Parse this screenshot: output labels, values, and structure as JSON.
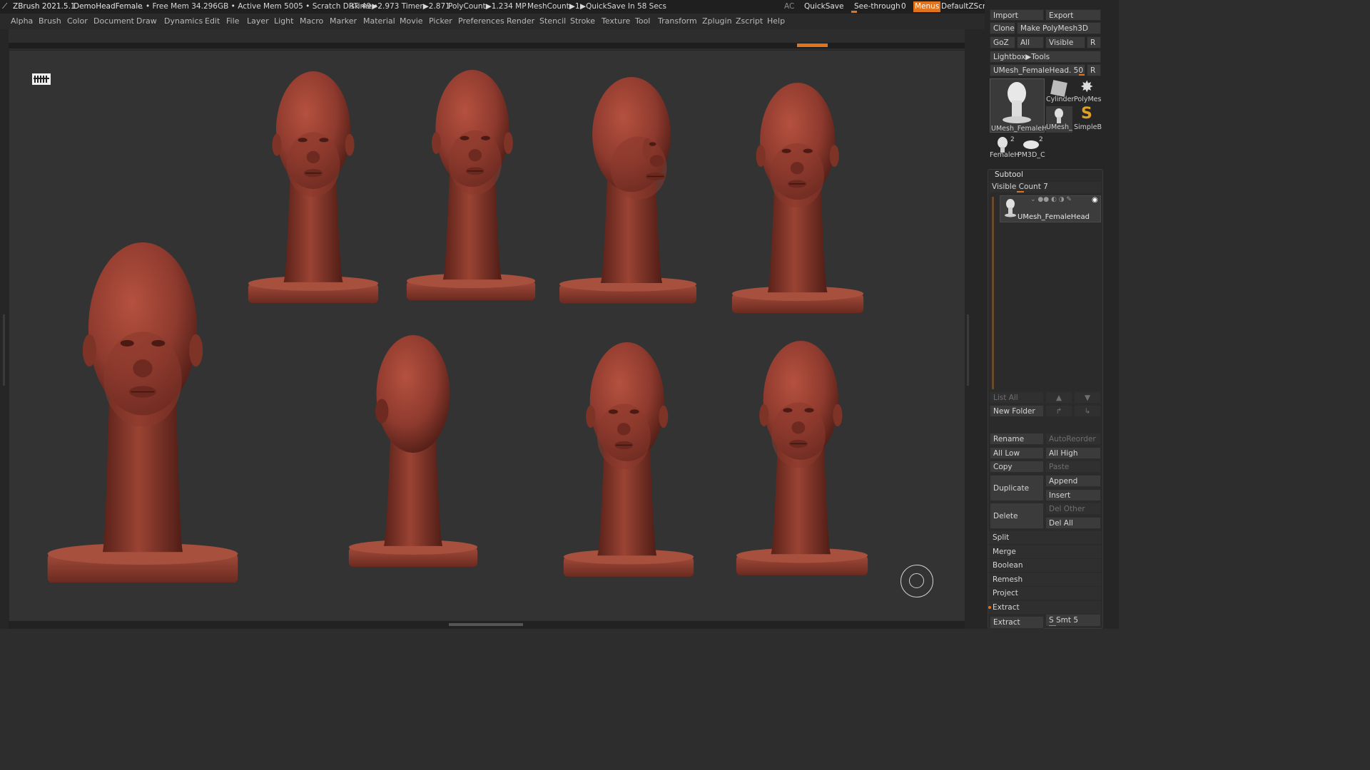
{
  "titlebar": {
    "app": "ZBrush 2021.5.1",
    "document": "DemoHeadFemale",
    "stats": ".. • Free Mem 34.296GB • Active Mem 5005 • Scratch Disk 49 •",
    "rtime": "RTime▶2.973 Timer▶2.871",
    "polycount": "PolyCount▶1.234 MP",
    "meshcount": "MeshCount▶1",
    "quicksave_status": "▶QuickSave In 58 Secs",
    "ac": "AC",
    "quicksave": "QuickSave",
    "seethrough_label": "See-through",
    "seethrough_value": "0",
    "menus": "Menus",
    "script": "DefaultZScript",
    "accent": "#e0731d"
  },
  "menubar": [
    "Alpha",
    "Brush",
    "Color",
    "Document",
    "Draw",
    "Dynamics",
    "Edit",
    "File",
    "Layer",
    "Light",
    "Macro",
    "Marker",
    "Material",
    "Movie",
    "Picker",
    "Preferences",
    "Render",
    "Stencil",
    "Stroke",
    "Texture",
    "Tool",
    "Transform",
    "Zplugin",
    "Zscript",
    "Help"
  ],
  "viewport": {
    "model_color": "#8e3a2e"
  },
  "tool": {
    "import": "Import",
    "export": "Export",
    "clone": "Clone",
    "make_polymesh": "Make PolyMesh3D",
    "goz": "GoZ",
    "all": "All",
    "visible": "Visible",
    "r": "R",
    "lightbox": "Lightbox▶Tools",
    "current_tool": "UMesh_FemaleHead. 50",
    "thumbs": {
      "main": "UMesh_FemaleH",
      "cylinder": "Cylinder",
      "polymesh": "PolyMes",
      "umesh": "UMesh_",
      "simpleb": "SimpleB",
      "female": "FemaleH",
      "pm3d": "PM3D_C",
      "female_count": "2",
      "pm3d_count": "2"
    }
  },
  "subtool": {
    "title": "Subtool",
    "visible_count": "Visible Count 7",
    "item_name": "UMesh_FemaleHead",
    "list_all": "List All",
    "new_folder": "New Folder",
    "rename": "Rename",
    "auto_reorder": "AutoReorder",
    "all_low": "All Low",
    "all_high": "All High",
    "copy": "Copy",
    "paste": "Paste",
    "duplicate": "Duplicate",
    "append": "Append",
    "insert": "Insert",
    "delete": "Delete",
    "del_other": "Del Other",
    "del_all": "Del All",
    "sections": [
      "Split",
      "Merge",
      "Boolean",
      "Remesh",
      "Project",
      "Extract"
    ],
    "extract_btn": "Extract",
    "s_smt": "S Smt 5"
  }
}
